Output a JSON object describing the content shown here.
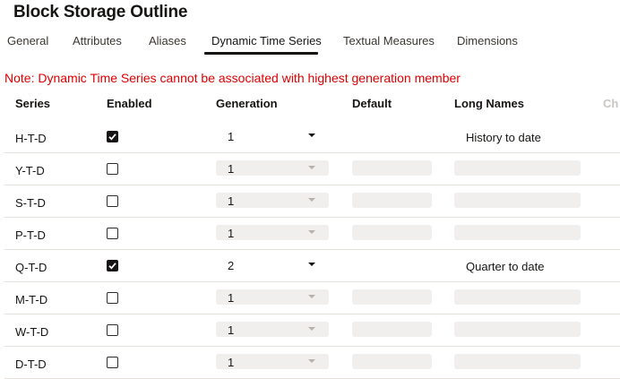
{
  "title": "Block Storage Outline",
  "tabs": [
    {
      "label": "General"
    },
    {
      "label": "Attributes"
    },
    {
      "label": "Aliases"
    },
    {
      "label": "Dynamic Time Series",
      "active": true
    },
    {
      "label": "Textual Measures"
    },
    {
      "label": "Dimensions"
    }
  ],
  "note": "Note: Dynamic Time Series cannot be associated with highest generation member",
  "columns": {
    "series": "Series",
    "enabled": "Enabled",
    "generation": "Generation",
    "default": "Default",
    "long_names": "Long Names",
    "clipped": "Ch"
  },
  "rows": [
    {
      "series": "H-T-D",
      "enabled": true,
      "generation": "1",
      "long_name": "History to date"
    },
    {
      "series": "Y-T-D",
      "enabled": false,
      "generation": "1",
      "long_name": ""
    },
    {
      "series": "S-T-D",
      "enabled": false,
      "generation": "1",
      "long_name": ""
    },
    {
      "series": "P-T-D",
      "enabled": false,
      "generation": "1",
      "long_name": ""
    },
    {
      "series": "Q-T-D",
      "enabled": true,
      "generation": "2",
      "long_name": "Quarter to date"
    },
    {
      "series": "M-T-D",
      "enabled": false,
      "generation": "1",
      "long_name": ""
    },
    {
      "series": "W-T-D",
      "enabled": false,
      "generation": "1",
      "long_name": ""
    },
    {
      "series": "D-T-D",
      "enabled": false,
      "generation": "1",
      "long_name": ""
    }
  ],
  "colors": {
    "note": "#e00000",
    "text": "#161513",
    "disabled_field": "#f1efed"
  }
}
